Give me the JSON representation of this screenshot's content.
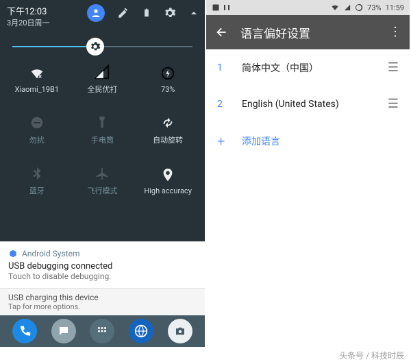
{
  "left": {
    "time": "下午12:03",
    "date": "3月20日周一",
    "brightness_percent": 46,
    "tiles": [
      {
        "label": "Xiaomi_19B1",
        "icon": "wifi"
      },
      {
        "label": "全民优打",
        "icon": "signal"
      },
      {
        "label": "73%",
        "icon": "battery-charging"
      },
      {
        "label": "勿扰",
        "icon": "dnd",
        "dim": true
      },
      {
        "label": "手电筒",
        "icon": "flashlight",
        "dim": true
      },
      {
        "label": "自动旋转",
        "icon": "auto-rotate"
      },
      {
        "label": "蓝牙",
        "icon": "bluetooth",
        "dim": true
      },
      {
        "label": "飞行模式",
        "icon": "airplane",
        "dim": true
      },
      {
        "label": "High accuracy",
        "icon": "location"
      }
    ],
    "notif1": {
      "app": "Android System",
      "title": "USB debugging connected",
      "sub": "Touch to disable debugging."
    },
    "notif2": {
      "title": "USB charging this device",
      "sub": "Tap for more options."
    }
  },
  "right": {
    "battery": "73%",
    "time": "11:59",
    "title": "语言偏好设置",
    "langs": [
      {
        "num": "1",
        "name": "简体中文（中国）"
      },
      {
        "num": "2",
        "name": "English (United States)"
      }
    ],
    "add": "添加语言"
  },
  "watermark": "头条号 / 科技时辰"
}
